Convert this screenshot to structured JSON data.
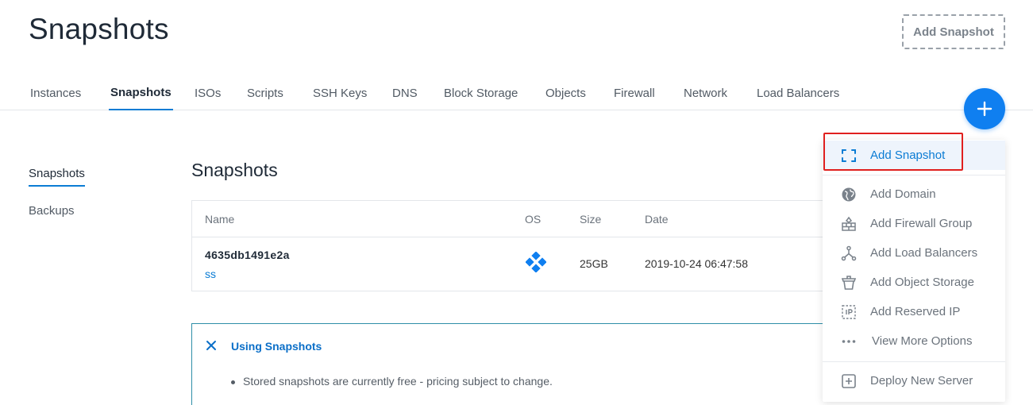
{
  "header": {
    "title": "Snapshots",
    "add_button_label": "Add Snapshot"
  },
  "tabs": [
    {
      "label": "Instances"
    },
    {
      "label": "Snapshots",
      "active": true
    },
    {
      "label": "ISOs"
    },
    {
      "label": "Scripts"
    },
    {
      "label": "SSH Keys"
    },
    {
      "label": "DNS"
    },
    {
      "label": "Block Storage"
    },
    {
      "label": "Objects"
    },
    {
      "label": "Firewall"
    },
    {
      "label": "Network"
    },
    {
      "label": "Load Balancers"
    }
  ],
  "side_nav": [
    {
      "label": "Snapshots",
      "active": true
    },
    {
      "label": "Backups"
    }
  ],
  "section": {
    "title": "Snapshots"
  },
  "table": {
    "columns": [
      "Name",
      "OS",
      "Size",
      "Date"
    ],
    "rows": [
      {
        "name": "4635db1491e2a",
        "label": "ss",
        "os_icon": "os-diamond-icon",
        "size": "25GB",
        "date": "2019-10-24 06:47:58"
      }
    ]
  },
  "info": {
    "title": "Using Snapshots",
    "bullets": [
      "Stored snapshots are currently free - pricing subject to change."
    ]
  },
  "fab": {
    "icon": "plus-icon"
  },
  "dropdown": {
    "items": [
      {
        "label": "Add Snapshot",
        "icon": "snapshot-frame-icon"
      },
      {
        "label": "Add Domain",
        "icon": "globe-icon"
      },
      {
        "label": "Add Firewall Group",
        "icon": "firewall-icon"
      },
      {
        "label": "Add Load Balancers",
        "icon": "load-balancer-icon"
      },
      {
        "label": "Add Object Storage",
        "icon": "object-storage-icon"
      },
      {
        "label": "Add Reserved IP",
        "icon": "reserved-ip-icon"
      },
      {
        "label": "View More Options",
        "icon": "more-dots-icon"
      },
      {
        "label": "Deploy New Server",
        "icon": "plus-square-icon"
      }
    ]
  },
  "colors": {
    "accent": "#0f7ff0",
    "link": "#0b7cd4",
    "highlight_bg": "#eef4fc",
    "focus_border": "#e0201e"
  }
}
